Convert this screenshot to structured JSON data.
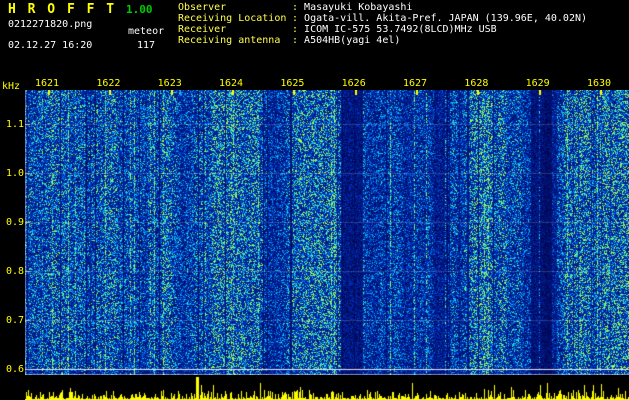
{
  "header": {
    "app_title": "H R O F F T",
    "version": "1.00",
    "filename": "0212271820.png",
    "mode_label": "meteor",
    "datetime": "02.12.27 16:20",
    "count": "117",
    "info_rows": [
      {
        "label": "Observer",
        "value": "Masayuki Kobayashi"
      },
      {
        "label": "Receiving Location",
        "value": "Ogata-vill. Akita-Pref. JAPAN (139.96E, 40.02N)"
      },
      {
        "label": "Receiver",
        "value": "ICOM IC-575 53.7492(8LCD)MHz USB"
      },
      {
        "label": "Receiving antenna",
        "value": "A504HB(yagi 4el)"
      }
    ]
  },
  "axes": {
    "freq_unit": "kHz",
    "freq_ticks": [
      "1.1",
      "1.0",
      "0.9",
      "0.8",
      "0.7",
      "0.6"
    ],
    "time_ticks": [
      "1621",
      "1622",
      "1623",
      "1624",
      "1625",
      "1626",
      "1627",
      "1628",
      "1629",
      "1630"
    ]
  },
  "chart_data": {
    "type": "heatmap",
    "title": "HROFFT radio meteor observation spectrogram",
    "x_tick_labels": [
      "1621",
      "1622",
      "1623",
      "1624",
      "1625",
      "1626",
      "1627",
      "1628",
      "1629",
      "1630"
    ],
    "x_axis_meaning": "time of day (HHMM), 16:21 to 16:30",
    "ylabel": "kHz",
    "y_tick_values": [
      1.1,
      1.0,
      0.9,
      0.8,
      0.7,
      0.6
    ],
    "y_range_khz": [
      0.58,
      1.17
    ],
    "grid": "faint horizontal lines at each 0.1 kHz tick, solid white line at 0.6 kHz",
    "legend": "none",
    "content": "broadband blue background noise with dense vertical cyan/green streaks (meteor echoes and noise bursts) across all ten minutes; brighter blue region at far right; yellow signal-level bar strip along the bottom with one tall spike near the 1623-1624 boundary"
  },
  "colors": {
    "background": "#000000",
    "title_yellow": "#ffff00",
    "version_green": "#00cc00",
    "text_white": "#ffffff",
    "label_yellow": "#ffff4d",
    "tick_yellow": "#ffff00",
    "meter_yellow": "#ffff00",
    "axis_white": "#c8c8c8",
    "noise_low": "#000046",
    "noise_mid": "#0038d0",
    "noise_high": "#00d2ff",
    "noise_peak": "#a0ff50"
  }
}
